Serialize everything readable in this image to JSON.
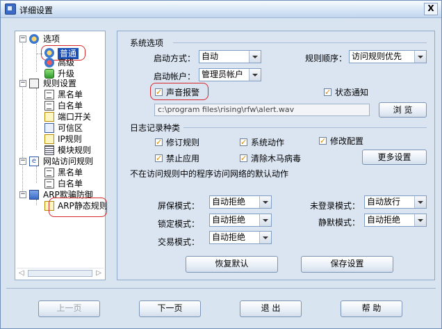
{
  "window": {
    "title": "详细设置",
    "close_symbol": "X"
  },
  "tree": {
    "options": "选项",
    "general": "普通",
    "advanced": "高级",
    "upgrade": "升级",
    "rules": "规则设置",
    "blacklist": "黑名单",
    "whitelist": "白名单",
    "port_switch": "端口开关",
    "trusted_zone": "可信区",
    "ip_rules": "IP规则",
    "module_rules": "模块规则",
    "web_access": "网站访问规则",
    "web_blacklist": "黑名单",
    "web_whitelist": "白名单",
    "arp_defense": "ARP欺骗防御",
    "arp_static": "ARP静态规则"
  },
  "system": {
    "section_title": "系统选项",
    "startup_mode_label": "启动方式：",
    "startup_mode_value": "自动",
    "rule_order_label": "规则顺序：",
    "rule_order_value": "访问规则优先",
    "startup_account_label": "启动帐户：",
    "startup_account_value": "管理员帐户",
    "sound_alarm": "声音报警",
    "status_notify": "状态通知",
    "sound_path": "c:\\program files\\rising\\rfw\\alert.wav",
    "browse": "浏 览"
  },
  "log": {
    "section_title": "日志记录种类",
    "modify_rules": "修订规则",
    "system_actions": "系统动作",
    "modify_config": "修改配置",
    "block_apps": "禁止应用",
    "clear_trojans": "清除木马病毒",
    "more_settings": "更多设置"
  },
  "default_action": {
    "title": "不在访问规则中的程序访问网络的默认动作",
    "screensaver_label": "屏保模式：",
    "screensaver_value": "自动拒绝",
    "not_logged_label": "未登录模式：",
    "not_logged_value": "自动放行",
    "locked_label": "锁定模式：",
    "locked_value": "自动拒绝",
    "silent_label": "静默模式：",
    "silent_value": "自动拒绝",
    "trade_label": "交易模式：",
    "trade_value": "自动拒绝",
    "restore_default": "恢复默认",
    "save_settings": "保存设置"
  },
  "footer": {
    "prev": "上一页",
    "next": "下一页",
    "exit": "退 出",
    "help": "帮 助"
  }
}
